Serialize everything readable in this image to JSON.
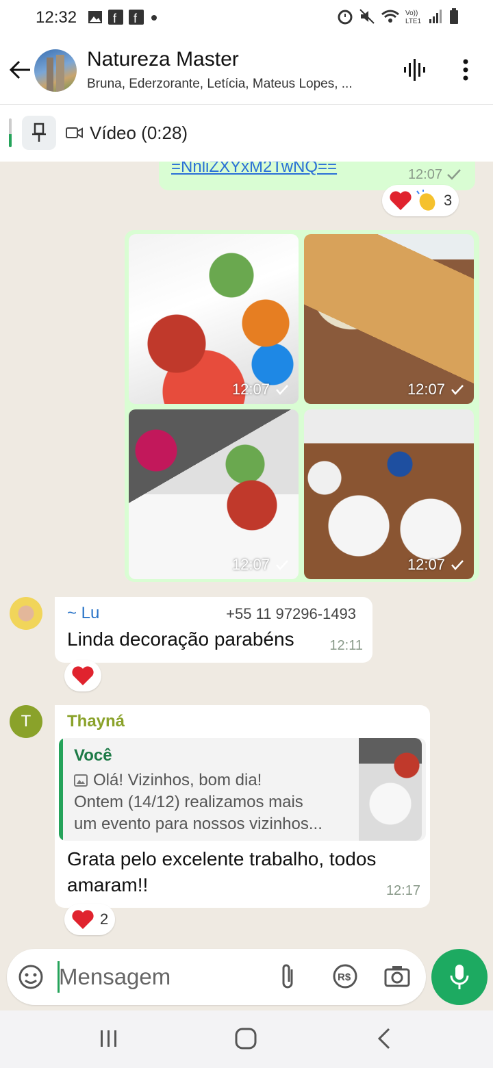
{
  "status_bar": {
    "time": "12:32"
  },
  "header": {
    "title": "Natureza Master",
    "subtitle": "Bruna, Ederzorante, Letícia, Mateus Lopes, ..."
  },
  "pinned": {
    "label": "Vídeo (0:28)"
  },
  "messages": {
    "link_msg": {
      "link": "=NnliZXYxM2TwNQ==",
      "time": "12:07",
      "reaction_count": "3"
    },
    "media": {
      "times": [
        "12:07",
        "12:07",
        "12:07",
        "12:07"
      ]
    },
    "lu": {
      "sender": "~ Lu",
      "phone": "+55 11 97296-1493",
      "text": "Linda decoração parabéns",
      "time": "12:11"
    },
    "thayna": {
      "avatar_letter": "T",
      "sender": "Thayná",
      "quote_author": "Você",
      "quote_line1": "Olá! Vizinhos, bom dia!",
      "quote_line2": "Ontem (14/12)  realizamos mais",
      "quote_line3": "um evento para nossos vizinhos...",
      "text": "Grata pelo excelente trabalho, todos amaram!!",
      "time": "12:17",
      "reaction_count": "2"
    }
  },
  "input": {
    "placeholder": "Mensagem"
  },
  "colors": {
    "accent": "#1daa61",
    "outgoing_bubble": "#d9fdd3",
    "chat_bg": "#efeae2"
  }
}
